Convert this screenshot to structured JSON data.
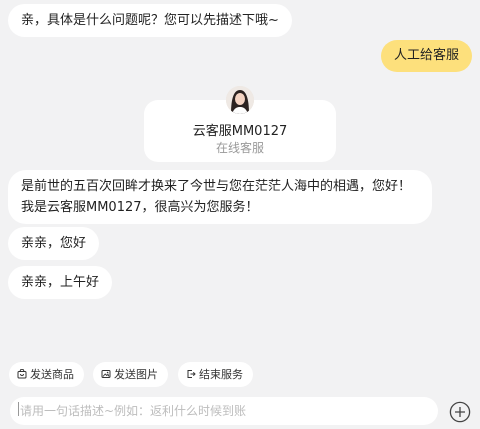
{
  "messages": [
    {
      "text": "亲，具体是什么问题呢？您可以先描述下哦~"
    },
    {
      "text": "是前世的五百次回眸才换来了今世与您在茫茫人海中的相遇，您好！我是云客服MM0127，很高兴为您服务！"
    },
    {
      "text": "亲亲，您好"
    },
    {
      "text": "亲亲，上午好"
    }
  ],
  "user_message": {
    "text": "人工给客服"
  },
  "agent": {
    "name": "云客服MM0127",
    "status": "在线客服"
  },
  "quick_actions": [
    {
      "label": "发送商品",
      "icon": "shop-bag-icon"
    },
    {
      "label": "发送图片",
      "icon": "image-icon"
    },
    {
      "label": "结束服务",
      "icon": "exit-icon"
    }
  ],
  "input": {
    "placeholder": "请用一句话描述~例如：返利什么时候到账",
    "value": ""
  },
  "colors": {
    "user_bubble": "#fde07c",
    "background": "#f2f2f3",
    "bubble": "#ffffff"
  }
}
